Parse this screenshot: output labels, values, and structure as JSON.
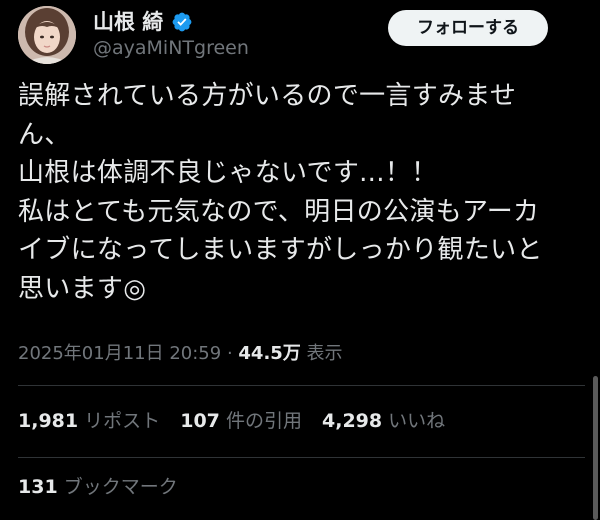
{
  "author": {
    "name": "山根 綺",
    "handle": "@ayaMiNTgreen",
    "verified_icon": "verified-badge-icon",
    "avatar_icon": "profile-photo"
  },
  "follow_button": {
    "label": "フォローする"
  },
  "tweet": {
    "lines": [
      "誤解されている方がいるので一言すみませ",
      "ん、",
      "山根は体調不良じゃないです...！！",
      "私はとても元気なので、明日の公演もアーカ",
      "イブになってしまいますがしっかり観たいと",
      "思います◎"
    ]
  },
  "meta": {
    "timestamp": "2025年01月11日 20:59",
    "separator": " · ",
    "views_count": "44.5万",
    "views_label": " 表示"
  },
  "stats": {
    "reposts_count": "1,981",
    "reposts_label": "リポスト",
    "quotes_count": "107",
    "quotes_label": "件の引用",
    "likes_count": "4,298",
    "likes_label": "いいね"
  },
  "bookmarks": {
    "count": "131",
    "label": "ブックマーク"
  },
  "colors": {
    "background": "#000000",
    "text_primary": "#e7e9ea",
    "text_secondary": "#71767b",
    "verified": "#1d9bf0",
    "follow_button_bg": "#eff3f4",
    "divider": "#2f3336"
  }
}
